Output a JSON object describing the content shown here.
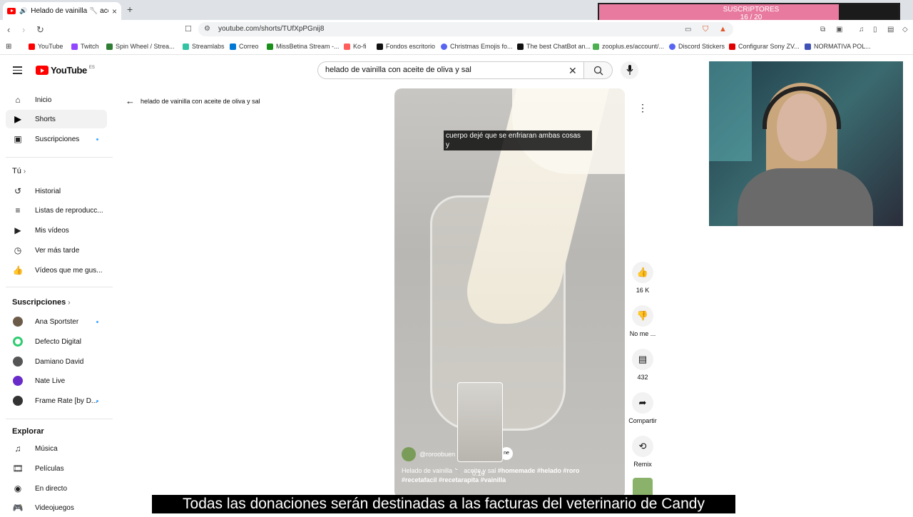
{
  "browser": {
    "tab_title": "Helado de vainilla 🥄 aceite",
    "tab_close": "×",
    "new_tab": "+",
    "url": "youtube.com/shorts/TUfXpPGnij8",
    "bookmarks": [
      {
        "label": "YouTube",
        "color": "#ff0000"
      },
      {
        "label": "Twitch",
        "color": "#9146ff"
      },
      {
        "label": "Spin Wheel / Strea...",
        "color": "#2e7d32"
      },
      {
        "label": "Streamlabs",
        "color": "#31c3a2"
      },
      {
        "label": "Correo",
        "color": "#0078d4"
      },
      {
        "label": "MissBetina Stream -...",
        "color": "#1a8f1a"
      },
      {
        "label": "Ko-fi",
        "color": "#ff5e5b"
      },
      {
        "label": "Fondos escritorio",
        "color": "#111111"
      },
      {
        "label": "Christmas Emojis fo...",
        "color": "#5865f2"
      },
      {
        "label": "The best ChatBot an...",
        "color": "#111111"
      },
      {
        "label": "zooplus.es/account/...",
        "color": "#4caf50"
      },
      {
        "label": "Discord Stickers",
        "color": "#5865f2"
      },
      {
        "label": "Configurar Sony ZV...",
        "color": "#e00000"
      },
      {
        "label": "NORMATIVA POL...",
        "color": "#3f51b5"
      }
    ]
  },
  "overlay": {
    "goal_label": "SUSCRIPTORES",
    "goal_count": "16 / 20",
    "goal_progress": 0.8,
    "goal_color": "#e87aa0",
    "ticker": "Todas las donaciones serán destinadas a las facturas del veterinario de Candy"
  },
  "youtube": {
    "logo_text": "YouTube",
    "region": "ES",
    "search_value": "helado de vainilla con aceite de oliva y sal",
    "back_label": "helado de vainilla con aceite de oliva y sal",
    "nav": [
      {
        "label": "Inicio",
        "icon": "home-icon"
      },
      {
        "label": "Shorts",
        "icon": "shorts-icon"
      },
      {
        "label": "Suscripciones",
        "icon": "subscriptions-icon"
      }
    ],
    "you_header": "Tú",
    "you_items": [
      {
        "label": "Historial",
        "icon": "history-icon"
      },
      {
        "label": "Listas de reproducc...",
        "icon": "playlist-icon"
      },
      {
        "label": "Mis vídeos",
        "icon": "video-icon"
      },
      {
        "label": "Ver más tarde",
        "icon": "clock-icon"
      },
      {
        "label": "Vídeos que me gus...",
        "icon": "like-icon"
      }
    ],
    "subs_header": "Suscripciones",
    "subs": [
      {
        "label": "Ana Sportster",
        "color": "#6d5b4a",
        "dot": true
      },
      {
        "label": "Defecto Digital",
        "color": "#2ecc71",
        "dot": false
      },
      {
        "label": "Damiano David",
        "color": "#555555",
        "dot": false
      },
      {
        "label": "Nate Live",
        "color": "#6a2cc9",
        "dot": false
      },
      {
        "label": "Frame Rate [by D...",
        "color": "#333333",
        "dot": true
      }
    ],
    "explore_header": "Explorar",
    "explore": [
      {
        "label": "Música",
        "icon": "music-icon"
      },
      {
        "label": "Películas",
        "icon": "film-icon"
      },
      {
        "label": "En directo",
        "icon": "live-icon"
      },
      {
        "label": "Videojuegos",
        "icon": "gaming-icon"
      }
    ]
  },
  "short": {
    "caption_line1": "cuerpo dejé que se enfriaran ambas cosas",
    "caption_line2": "y",
    "thumb_time": "0:16",
    "channel": "@roroobuen",
    "subscribe": "ne",
    "description": "Helado de vainilla 🥄 aceite y sal",
    "hashtags": "#homemade #helado #roro #recetafacil #recetarapita #vainilla",
    "likes": "16 K",
    "dislike_label": "No me ...",
    "comments": "432",
    "share": "Compartir",
    "remix": "Remix"
  }
}
